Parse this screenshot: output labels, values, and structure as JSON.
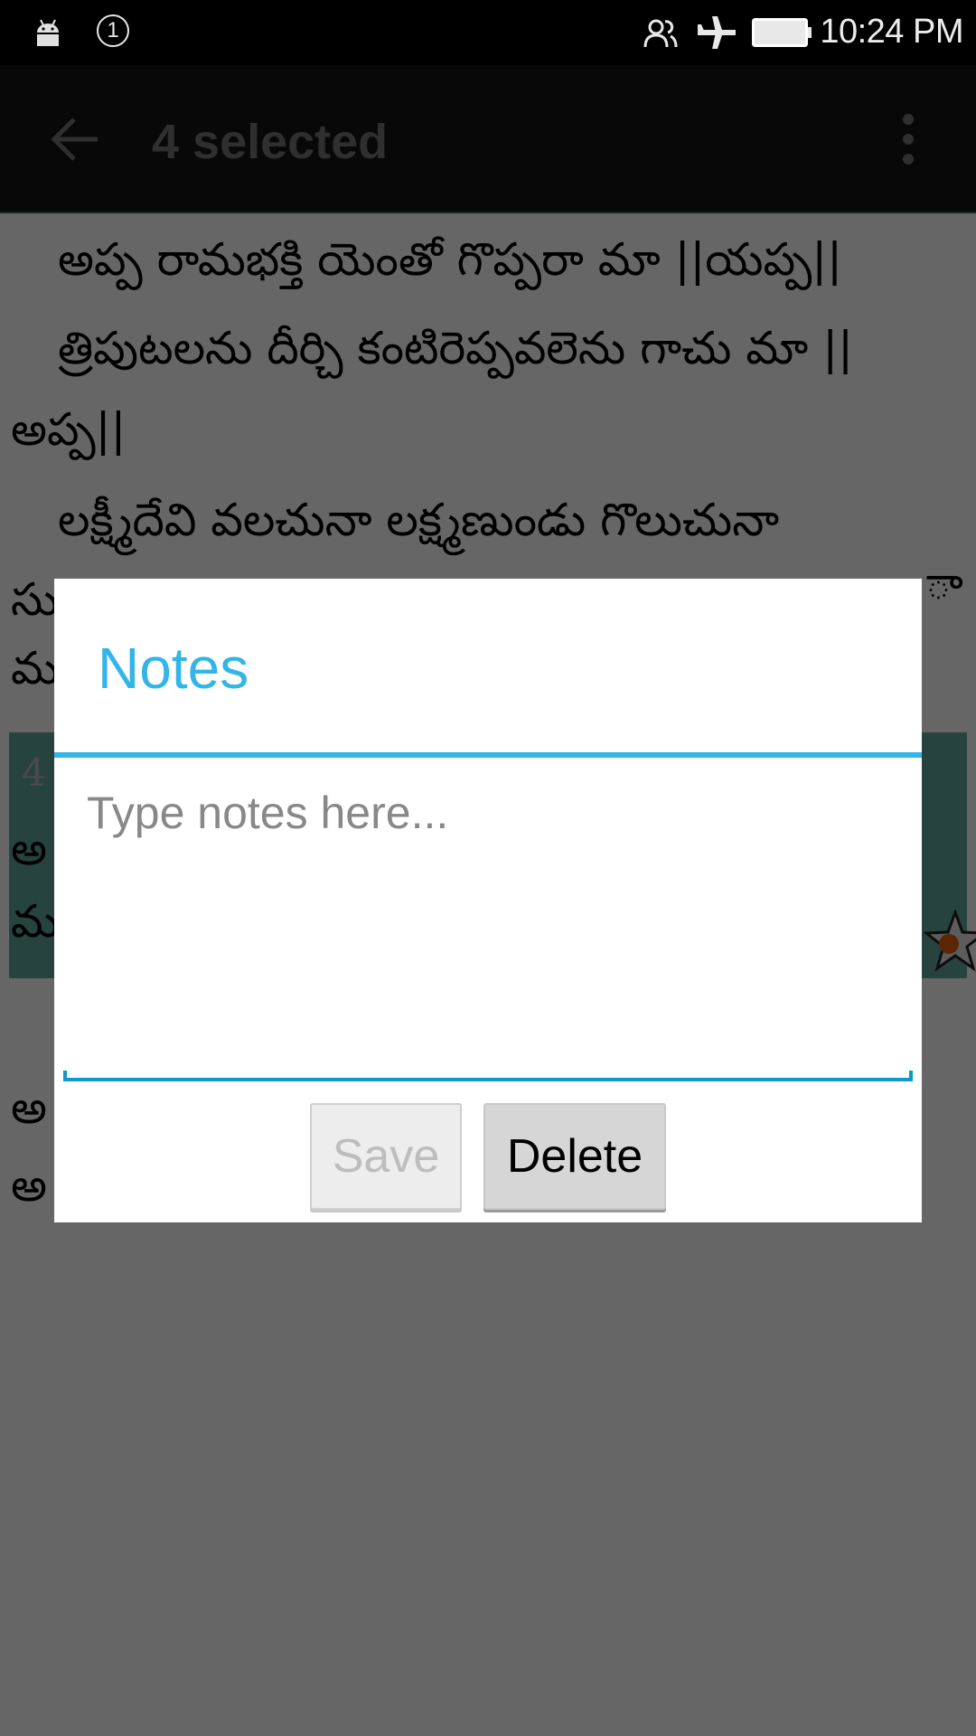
{
  "status_bar": {
    "left_icons": [
      "android-icon",
      "notification-count-icon"
    ],
    "notification_count": "1",
    "right_icons": [
      "contacts-icon",
      "airplane-mode-icon",
      "battery-icon"
    ],
    "time": "10:24 PM"
  },
  "action_bar": {
    "back_icon": "arrow-back-icon",
    "title": "4 selected",
    "overflow_icon": "more-vert-icon"
  },
  "content": {
    "lines": [
      "అప్ప రామభక్తి యెంతో గొప్పరా మా ||యప్ప||",
      "త్రిపుటలను దీర్చి కంటిరెప్పవలెను గాచు మా ||",
      "అప్ప||",
      "లక్ష్మీదేవి వలచునా లక్ష్మణుండు గొలుచునా",
      "సు",
      "మ"
    ],
    "line_fragment_right": "ా",
    "highlighted_verse": {
      "number": "4",
      "lines": [
        "అ",
        "మ"
      ],
      "star_icon": "star-bookmark-icon",
      "highlight_color": "#62a89c"
    },
    "lines_after": [
      "అ",
      "అ"
    ]
  },
  "dialog": {
    "title": "Notes",
    "accent_color": "#33b5e5",
    "notes_input": {
      "value": "",
      "placeholder": "Type notes here..."
    },
    "buttons": {
      "save_label": "Save",
      "save_enabled": false,
      "delete_label": "Delete"
    }
  }
}
